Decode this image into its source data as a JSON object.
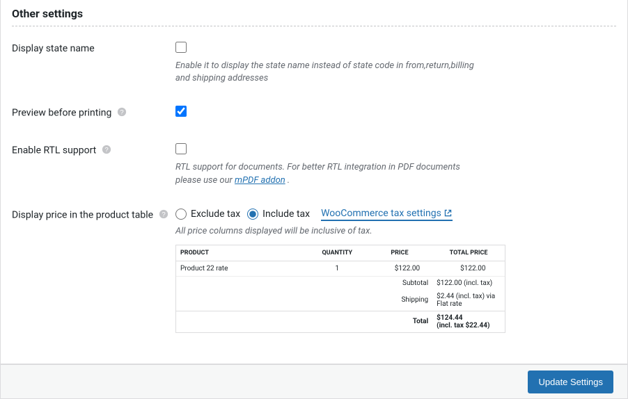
{
  "section_title": "Other settings",
  "fields": {
    "state_name": {
      "label": "Display state name",
      "checked": false,
      "desc": "Enable it to display the state name instead of state code in from,return,billing and shipping addresses"
    },
    "preview": {
      "label": "Preview before printing",
      "checked": true
    },
    "rtl": {
      "label": "Enable RTL support",
      "checked": false,
      "desc_pre": "RTL support for documents. For better RTL integration in PDF documents please use our ",
      "link_text": "mPDF addon",
      "desc_post": " ."
    },
    "price_display": {
      "label": "Display price in the product table",
      "options": {
        "exclude": "Exclude tax",
        "include": "Include tax"
      },
      "selected": "include",
      "woo_link": "WooCommerce tax settings",
      "desc": "All price columns displayed will be inclusive of tax."
    }
  },
  "preview_table": {
    "headers": {
      "product": "PRODUCT",
      "quantity": "QUANTITY",
      "price": "PRICE",
      "total": "TOTAL PRICE"
    },
    "row": {
      "product": "Product 22 rate",
      "quantity": "1",
      "price": "$122.00",
      "total": "$122.00"
    },
    "subtotal_label": "Subtotal",
    "subtotal_value": "$122.00 (incl. tax)",
    "shipping_label": "Shipping",
    "shipping_value": "$2.44 (incl. tax) via Flat rate",
    "total_label": "Total",
    "total_value_line1": "$124.44",
    "total_value_line2": "(incl. tax $22.44)"
  },
  "footer": {
    "button": "Update Settings"
  }
}
